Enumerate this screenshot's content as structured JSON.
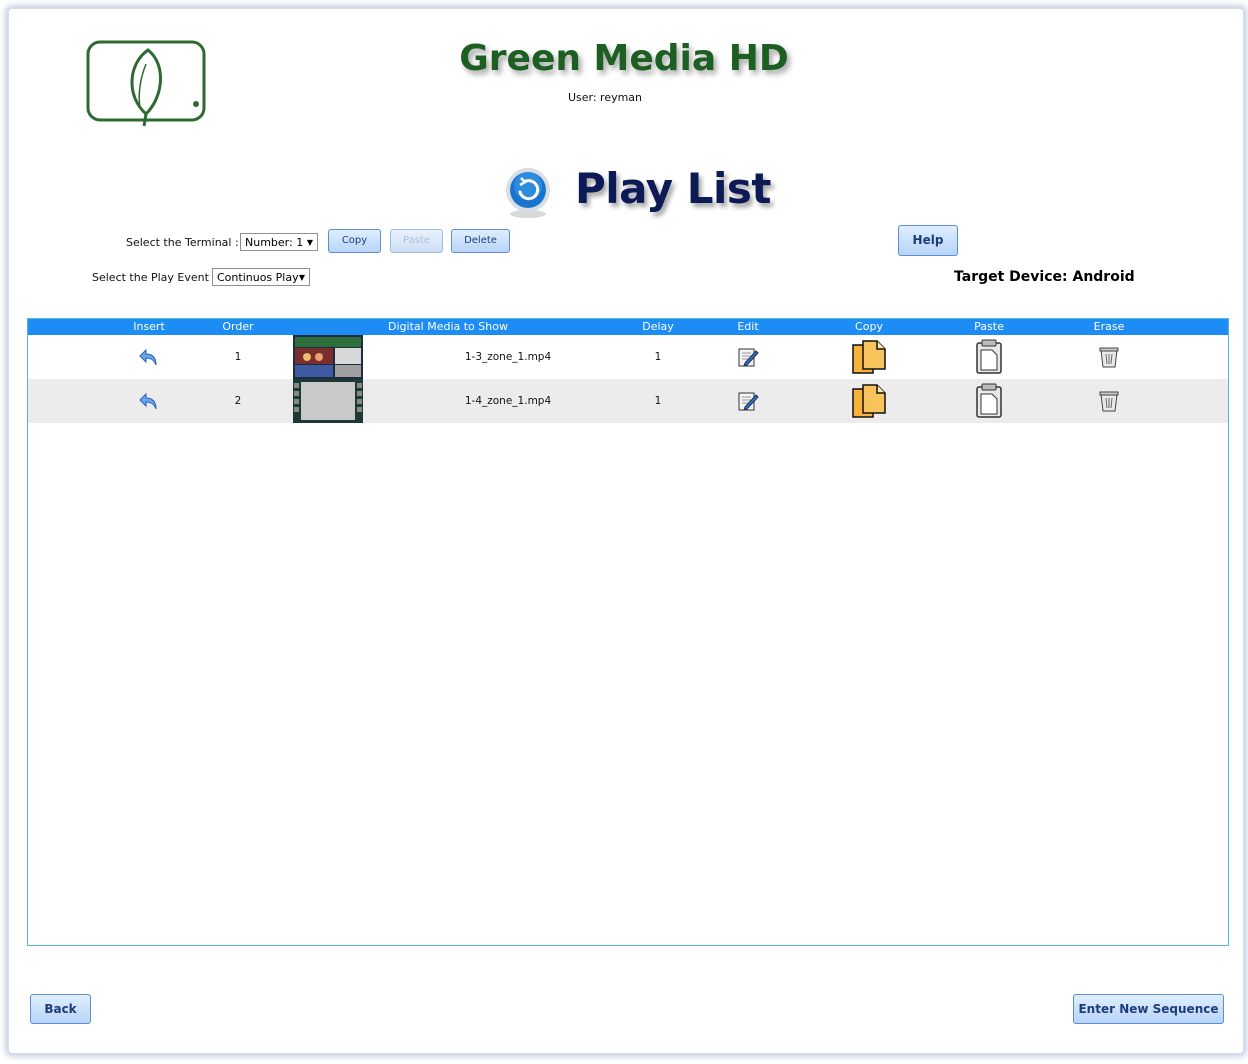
{
  "app": {
    "brand_title": "Green Media HD",
    "user_label": "User: reyman",
    "page_title": "Play List",
    "logo_text": "GREEN MEDIA HD"
  },
  "controls": {
    "terminal_label": "Select the Terminal :",
    "terminal_value": "Number: 1",
    "copy_label": "Copy",
    "paste_label": "Paste",
    "delete_label": "Delete",
    "help_label": "Help",
    "event_label": "Select the Play Event :",
    "event_value": "Continuos Play",
    "target_device": "Target Device: Android"
  },
  "table": {
    "columns": [
      "Insert",
      "Order",
      "Digital Media to Show",
      "Delay",
      "Edit",
      "Copy",
      "Paste",
      "Erase"
    ],
    "rows": [
      {
        "order": "1",
        "media": "1-3_zone_1.mp4",
        "delay": "1"
      },
      {
        "order": "2",
        "media": "1-4_zone_1.mp4",
        "delay": "1"
      }
    ]
  },
  "footer": {
    "back_label": "Back",
    "new_sequence_label": "Enter New Sequence"
  },
  "colors": {
    "header_bar": "#1e8cf5",
    "brand_green": "#1d5f22",
    "title_navy": "#0c1a55"
  },
  "icons": [
    "logo-icon",
    "refresh-icon",
    "insert-arrow-icon",
    "edit-icon",
    "copy-icon",
    "paste-icon",
    "trash-icon"
  ]
}
